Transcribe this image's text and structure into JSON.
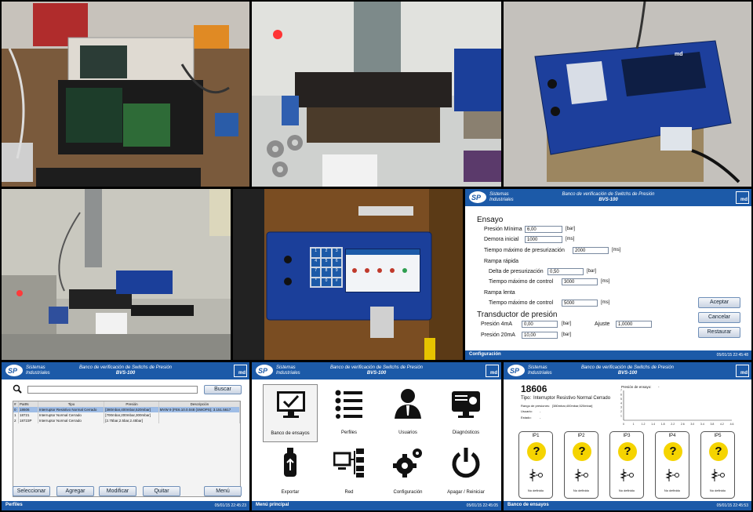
{
  "configuracion": {
    "header_brand": "Sistemas\nIndustriales",
    "header_title": "Banco de verificación de Switchs de Presión",
    "header_subtitle": "BVS-100",
    "logo_md": "md",
    "section_ensayo": "Ensayo",
    "presion_minima_label": "Presión Mínima",
    "presion_minima_value": "6,00",
    "presion_minima_unit": "[bar]",
    "demora_inicial_label": "Demora inicial",
    "demora_inicial_value": "1000",
    "demora_inicial_unit": "[ms]",
    "tiempo_max_presurizacion_label": "Tiempo máximo de presurización",
    "tiempo_max_presurizacion_value": "2000",
    "tiempo_max_presurizacion_unit": "[ms]",
    "rampa_rapida": "Rampa rápida",
    "delta_presurizacion_label": "Delta de presurización",
    "delta_presurizacion_value": "0,50",
    "delta_presurizacion_unit": "[bar]",
    "tiempo_max_control_label": "Tiempo máximo de control",
    "tiempo_max_control_value": "3000",
    "tiempo_max_control_unit": "[ms]",
    "rampa_lenta": "Rampa lenta",
    "tiempo_max_control_lenta_label": "Tiempo máximo de control",
    "tiempo_max_control_lenta_value": "5000",
    "tiempo_max_control_lenta_unit": "[ms]",
    "section_transductor": "Transductor de presión",
    "presion_4ma_label": "Presión 4mA",
    "presion_4ma_value": "0,00",
    "presion_4ma_unit": "[bar]",
    "ajuste_label": "Ajuste",
    "ajuste_value": "1,0000",
    "presion_20ma_label": "Presión 20mA",
    "presion_20ma_value": "10,00",
    "presion_20ma_unit": "[bar]",
    "btn_aceptar": "Aceptar",
    "btn_cancelar": "Cancelar",
    "btn_restaurar": "Restaurar",
    "footer_label": "Configuración",
    "footer_timestamp": "05/01/15 22:45:48"
  },
  "perfiles": {
    "header_brand": "Sistemas\nIndustriales",
    "header_title": "Banco de verificación de Switchs de Presión",
    "header_subtitle": "BVS-100",
    "logo_md": "md",
    "btn_buscar": "Buscar",
    "columns": [
      "#",
      "PartN",
      "Tipo",
      "Presión",
      "Descripción"
    ],
    "rows": [
      [
        "0",
        "18606",
        "Interruptor Resistivo Normal Cerrado",
        "[380mbar,400mbar,520mbar]",
        "MVW 9 (FE6.10.0.048 (SWOPS); 3.151.5617"
      ],
      [
        "1",
        "18721",
        "Interruptor Normal Cerrado",
        "[700mbar,200mbar,300mbar]",
        ""
      ],
      [
        "2",
        "18723P",
        "Interruptor Normal Cerrado",
        "[2.75bar,2.5bar,2.45bar]",
        ""
      ]
    ],
    "btn_seleccionar": "Seleccionar",
    "btn_agregar": "Agregar",
    "btn_modificar": "Modificar",
    "btn_quitar": "Quitar",
    "btn_menu": "Menú",
    "footer_label": "Perfiles",
    "footer_timestamp": "05/01/15 22:45:23"
  },
  "menu_principal": {
    "header_brand": "Sistemas\nIndustriales",
    "header_title": "Banco de verificación de Switchs de Presión",
    "header_subtitle": "BVS-100",
    "logo_md": "md",
    "items": [
      "Banco de ensayos",
      "Perfiles",
      "Usuarios",
      "Diagnósticos",
      "Exportar",
      "Red",
      "Configuración",
      "Apagar / Reiniciar"
    ],
    "footer_label": "Menú principal",
    "footer_timestamp": "05/01/15 22:45:05"
  },
  "banco_ensayos": {
    "header_brand": "Sistemas\nIndustriales",
    "header_title": "Banco de verificación de Switchs de Presión",
    "header_subtitle": "BVS-100",
    "logo_md": "md",
    "part_number": "18606",
    "tipo_label": "Tipo:",
    "tipo_value": "Interruptor Resistivo Normal Cerrado",
    "rangos_label": "Rango de presiones:",
    "rangos_value": "[380mbar,400mbar,520mbar]",
    "usuario_label": "Usuario:",
    "usuario_value": "-",
    "estado_label": "Estado:",
    "estado_value": "-",
    "chart_title": "Presión de ensayo:",
    "chart_title_value": "-",
    "ip_labels": [
      "IP1",
      "IP2",
      "IP3",
      "IP4",
      "IP5"
    ],
    "ip_status": "No definido",
    "footer_label": "Banco de ensayos",
    "footer_timestamp": "05/01/15 22:45:53"
  },
  "device_ui": {
    "panel_logo": "md",
    "panel_model": "BVS-100",
    "panel_title": "Banco de verificación de Switchs de Presión",
    "keypad_keys": [
      "1",
      "2",
      "3",
      "4",
      "5",
      "6",
      "7",
      "8",
      "9",
      "*",
      "0",
      "#"
    ]
  },
  "colors": {
    "header_blue": "#1c5aa8",
    "device_blue": "#1b3f9a",
    "warning_yellow": "#f5d400"
  },
  "chart_data": {
    "type": "line",
    "title": "Presión de ensayo:",
    "x_ticks": [
      "0",
      "1",
      "1.2",
      "1.4",
      "1.8",
      "2.2",
      "2.6",
      "3.0",
      "3.4",
      "3.8",
      "4.2",
      "4.6"
    ],
    "y_ticks": [
      "1",
      "2",
      "3",
      "4",
      "5",
      "6",
      "7"
    ],
    "series": []
  }
}
